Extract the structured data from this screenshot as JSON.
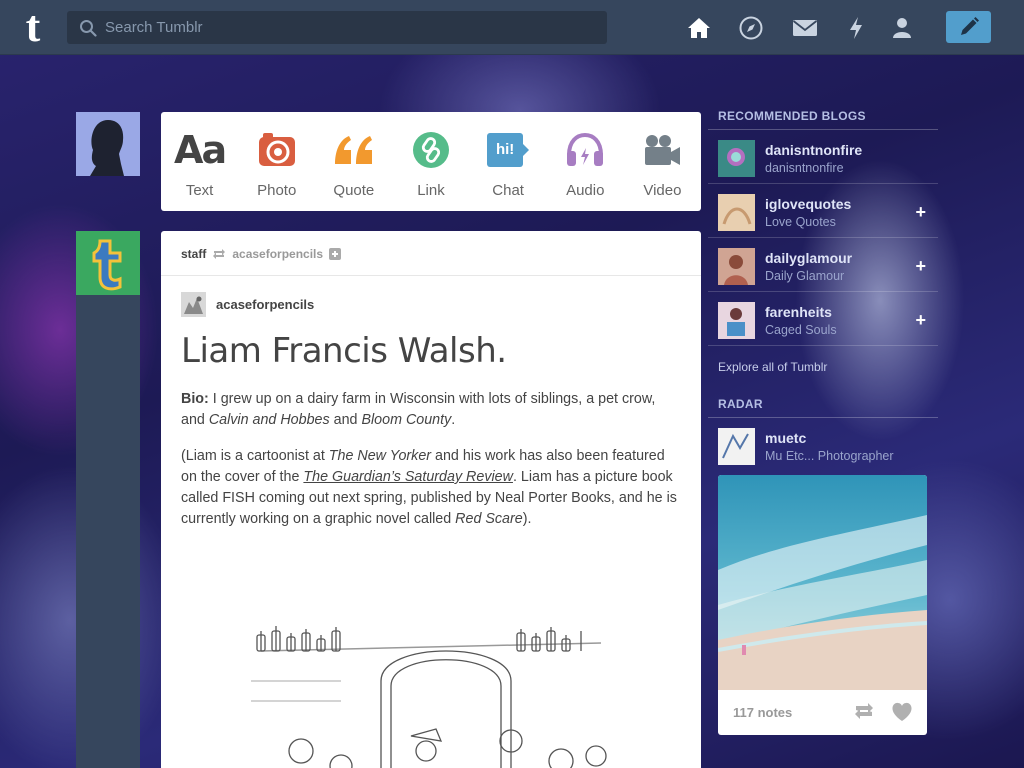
{
  "header": {
    "logo": "t",
    "search_placeholder": "Search Tumblr",
    "nav_icons": [
      "home-icon",
      "compass-icon",
      "mail-icon",
      "lightning-icon",
      "account-icon"
    ],
    "compose_icon": "pencil-icon",
    "background_color": "#36465d",
    "compose_color": "#529ecc"
  },
  "post_types": [
    {
      "label": "Text",
      "icon": "Aa",
      "color": "#444444"
    },
    {
      "label": "Photo",
      "icon": "camera-icon",
      "color": "#d95e40"
    },
    {
      "label": "Quote",
      "icon": "quote-icon",
      "color": "#f2992e"
    },
    {
      "label": "Link",
      "icon": "link-icon",
      "color": "#56bc8a"
    },
    {
      "label": "Chat",
      "icon": "hi!",
      "color": "#529ecc"
    },
    {
      "label": "Audio",
      "icon": "headphones-icon",
      "color": "#a77dc2"
    },
    {
      "label": "Video",
      "icon": "video-camera-icon",
      "color": "#748089"
    }
  ],
  "post": {
    "reblogger": "staff",
    "reblogged_from": "acaseforpencils",
    "author": "acaseforpencils",
    "title": "Liam Francis Walsh.",
    "bio_label": "Bio:",
    "bio_text_1": " I grew up on a dairy farm in Wisconsin with lots of siblings, a pet crow, and ",
    "bio_italic_1": "Calvin and Hobbes",
    "bio_text_2": " and ",
    "bio_italic_2": "Bloom County",
    "bio_text_3": ".",
    "para2_text_1": "(Liam is a cartoonist at ",
    "para2_italic_1": "The New Yorker",
    "para2_text_2": " and his work has also been featured on the cover of the ",
    "para2_link": "The Guardian’s Saturday Review",
    "para2_text_3": ". Liam has a picture book called FISH coming out next spring, published by Neal Porter Books, and he is currently working on a graphic novel called ",
    "para2_italic_2": "Red Scare",
    "para2_text_4": ")."
  },
  "sidebar": {
    "recommended_title": "RECOMMENDED BLOGS",
    "blogs": [
      {
        "name": "danisntnonfire",
        "subtitle": "danisntnonfire",
        "avatar_color": "#3a8a86"
      },
      {
        "name": "iglovequotes",
        "subtitle": "Love Quotes",
        "avatar_color": "#d9b38f"
      },
      {
        "name": "dailyglamour",
        "subtitle": "Daily Glamour",
        "avatar_color": "#c07a6a"
      },
      {
        "name": "farenheits",
        "subtitle": "Caged Souls",
        "avatar_color": "#c0a0b5"
      }
    ],
    "explore_label": "Explore all of Tumblr",
    "radar_title": "RADAR",
    "radar": {
      "name": "muetc",
      "subtitle": "Mu Etc... Photographer",
      "notes": "117 notes"
    }
  }
}
